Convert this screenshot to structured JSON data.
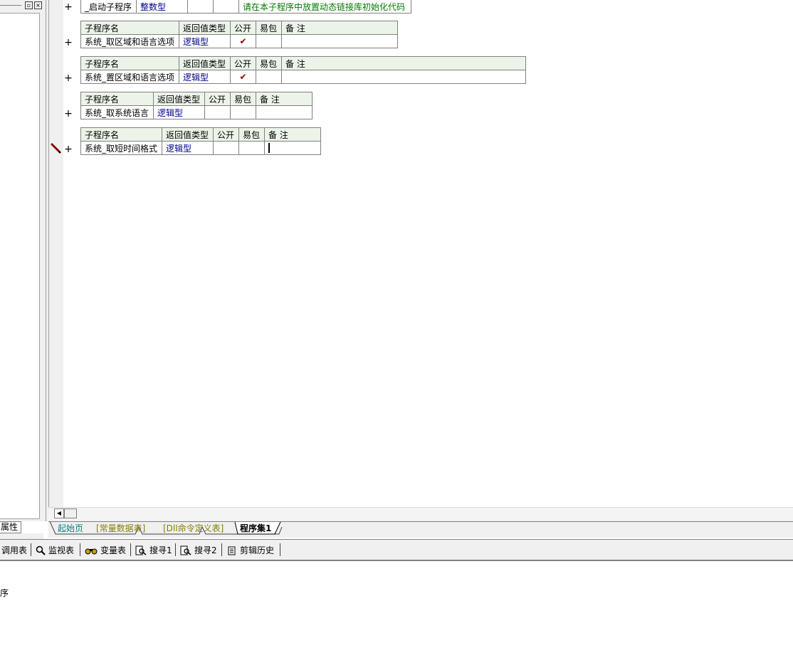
{
  "left_panel": {
    "tab_label": "属性"
  },
  "startup_row": {
    "name": "_启动子程序",
    "type": "整数型",
    "remark": "请在本子程序中放置动态链接库初始化代码"
  },
  "table_headers": {
    "name": "子程序名",
    "return_type": "返回值类型",
    "public": "公开",
    "easy_pkg": "易包",
    "remark": "备 注"
  },
  "subroutines": [
    {
      "name": "系统_取区域和语言选项",
      "type": "逻辑型",
      "public": "✔",
      "easy_pkg": "",
      "remark": ""
    },
    {
      "name": "系统_置区域和语言选项",
      "type": "逻辑型",
      "public": "✔",
      "easy_pkg": "",
      "remark": ""
    },
    {
      "name": "系统_取系统语言",
      "type": "逻辑型",
      "public": "",
      "easy_pkg": "",
      "remark": ""
    },
    {
      "name": "系统_取短时间格式",
      "type": "逻辑型",
      "public": "",
      "easy_pkg": "",
      "remark": ""
    }
  ],
  "plus_symbol": "+",
  "editor_tabs": [
    {
      "label": "起始页",
      "color": "#008080"
    },
    {
      "label": "[常量数据表]",
      "color": "#808000"
    },
    {
      "label": "[Dll命令定义表]",
      "color": "#808000"
    },
    {
      "label": "程序集1",
      "color": "#000000",
      "active": true
    }
  ],
  "toolbar": {
    "call_table": "调用表",
    "watch": "监视表",
    "variables": "变量表",
    "search1": "搜寻1",
    "search2": "搜寻2",
    "clip_history": "剪辑历史"
  },
  "output": {
    "text": "序"
  }
}
